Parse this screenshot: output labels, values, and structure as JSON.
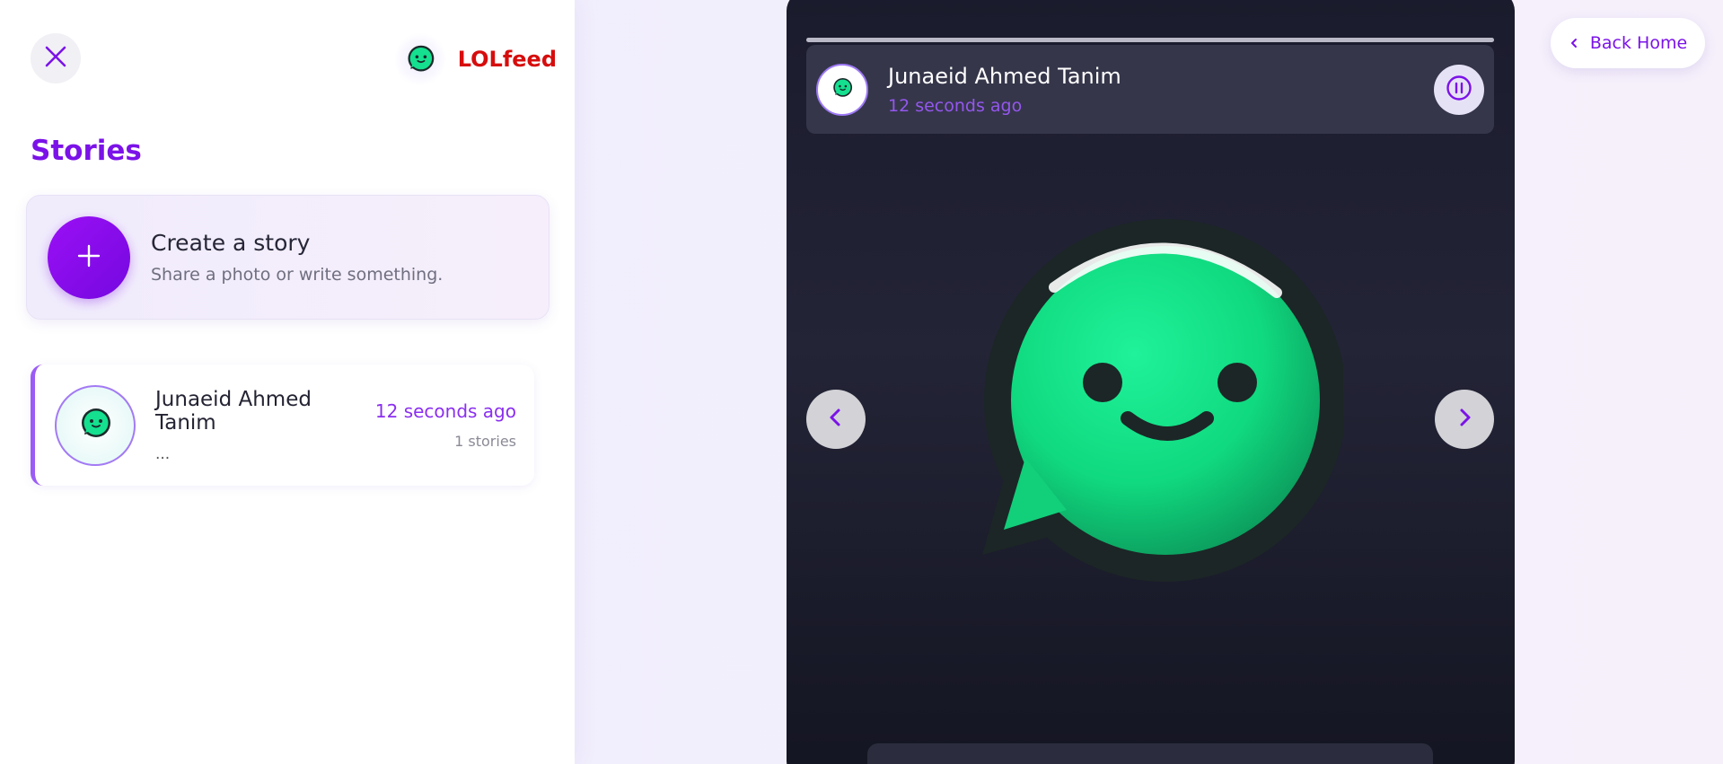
{
  "brand": {
    "name": "LOLfeed",
    "logo_icon": "chat-bubble-smile-icon",
    "name_color": "#d60d0d"
  },
  "sidebar": {
    "close_icon": "close-icon",
    "title": "Stories",
    "create": {
      "icon": "plus-icon",
      "title": "Create a story",
      "subtitle": "Share a photo or write something."
    },
    "stories": [
      {
        "name": "Junaeid Ahmed Tanim",
        "preview": "...",
        "time": "12 seconds ago",
        "count": "1 stories",
        "avatar_icon": "chat-bubble-smile-icon"
      }
    ]
  },
  "viewer": {
    "author": "Junaeid Ahmed Tanim",
    "time": "12 seconds ago",
    "progress": 1.0,
    "pause_icon": "pause-icon",
    "prev_icon": "chevron-left-icon",
    "next_icon": "chevron-right-icon",
    "image_icon": "chat-bubble-smile-icon"
  },
  "nav": {
    "back_home_label": "Back Home",
    "back_icon": "chevron-left-icon"
  },
  "colors": {
    "accent": "#7b12e8",
    "brand_red": "#d60d0d",
    "logo_green": "#10e38f"
  }
}
